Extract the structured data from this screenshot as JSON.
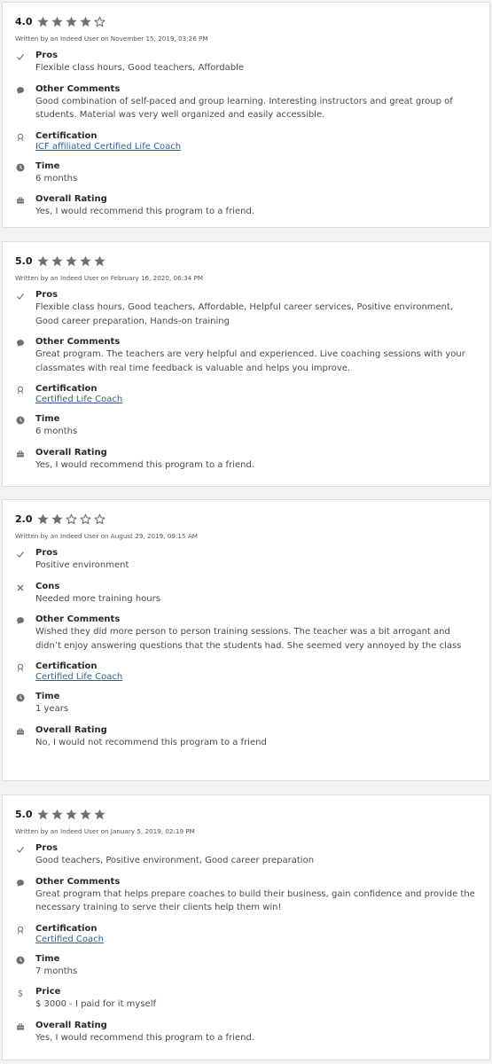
{
  "colors": {
    "star_filled": "#6f6f6f",
    "star_empty": "#6f6f6f",
    "link": "#2f5d9e",
    "icon": "#6f6f6f"
  },
  "reviews": [
    {
      "rating_text": "4.0",
      "stars": [
        1,
        1,
        1,
        1,
        0
      ],
      "byline": "Written by an Indeed User on November 15, 2019, 03:26 PM",
      "sections": [
        {
          "type": "pros",
          "icon": "checkmark-icon",
          "title": "Pros",
          "value": "Flexible class hours, Good teachers, Affordable"
        },
        {
          "type": "comments",
          "icon": "speech-bubble-icon",
          "title": "Other Comments",
          "value": "Good combination of self-paced and group learning. Interesting instructors and great group of students. Material was very well organized and easily accessible."
        },
        {
          "type": "certification",
          "icon": "award-ribbon-icon",
          "title": "Certification",
          "value": "ICF affiliated Certified Life Coach",
          "link": true
        },
        {
          "type": "time",
          "icon": "clock-icon",
          "title": "Time",
          "value": "6 months"
        },
        {
          "type": "overall",
          "icon": "briefcase-icon",
          "title": "Overall Rating",
          "value": "Yes, I would recommend this program to a friend."
        }
      ]
    },
    {
      "rating_text": "5.0",
      "stars": [
        1,
        1,
        1,
        1,
        1
      ],
      "byline": "Written by an Indeed User on February 16, 2020, 06:34 PM",
      "sections": [
        {
          "type": "pros",
          "icon": "checkmark-icon",
          "title": "Pros",
          "value": "Flexible class hours, Good teachers, Affordable, Helpful career services, Positive environment, Good career preparation, Hands-on training"
        },
        {
          "type": "comments",
          "icon": "speech-bubble-icon",
          "title": "Other Comments",
          "value": "Great program. The teachers are very helpful and experienced. Live coaching sessions with your classmates with real time feedback is valuable and helps you improve."
        },
        {
          "type": "certification",
          "icon": "award-ribbon-icon",
          "title": "Certification",
          "value": "Certified Life Coach",
          "link": true
        },
        {
          "type": "time",
          "icon": "clock-icon",
          "title": "Time",
          "value": "6 months"
        },
        {
          "type": "overall",
          "icon": "briefcase-icon",
          "title": "Overall Rating",
          "value": "Yes, I would recommend this program to a friend."
        }
      ]
    },
    {
      "rating_text": "2.0",
      "stars": [
        1,
        1,
        0,
        0,
        0
      ],
      "byline": "Written by an Indeed User on August 29, 2019, 09:15 AM",
      "sections": [
        {
          "type": "pros",
          "icon": "checkmark-icon",
          "title": "Pros",
          "value": "Positive environment"
        },
        {
          "type": "cons",
          "icon": "x-mark-icon",
          "title": "Cons",
          "value": "Needed more training hours"
        },
        {
          "type": "comments",
          "icon": "speech-bubble-icon",
          "title": "Other Comments",
          "value": "Wished they did more person to person training sessions. The teacher was a bit arrogant and didn’t enjoy answering questions that the students had. She seemed very annoyed by the class"
        },
        {
          "type": "certification",
          "icon": "award-ribbon-icon",
          "title": "Certification",
          "value": "Certified Life Coach",
          "link": true
        },
        {
          "type": "time",
          "icon": "clock-icon",
          "title": "Time",
          "value": "1 years"
        },
        {
          "type": "overall",
          "icon": "briefcase-icon",
          "title": "Overall Rating",
          "value": "No, I would not recommend this program to a friend"
        }
      ]
    },
    {
      "rating_text": "5.0",
      "stars": [
        1,
        1,
        1,
        1,
        1
      ],
      "byline": "Written by an Indeed User on January 5, 2019, 02:19 PM",
      "sections": [
        {
          "type": "pros",
          "icon": "checkmark-icon",
          "title": "Pros",
          "value": "Good teachers, Positive environment, Good career preparation"
        },
        {
          "type": "comments",
          "icon": "speech-bubble-icon",
          "title": "Other Comments",
          "value": "Great program that helps prepare coaches to build their business, gain confidence and provide the necessary training to serve their clients help them win!"
        },
        {
          "type": "certification",
          "icon": "award-ribbon-icon",
          "title": "Certification",
          "value": "Certified Coach",
          "link": true
        },
        {
          "type": "time",
          "icon": "clock-icon",
          "title": "Time",
          "value": "7 months"
        },
        {
          "type": "price",
          "icon": "dollar-icon",
          "title": "Price",
          "value": "$ 3000 - I paid for it myself"
        },
        {
          "type": "overall",
          "icon": "briefcase-icon",
          "title": "Overall Rating",
          "value": "Yes, I would recommend this program to a friend."
        }
      ]
    }
  ]
}
